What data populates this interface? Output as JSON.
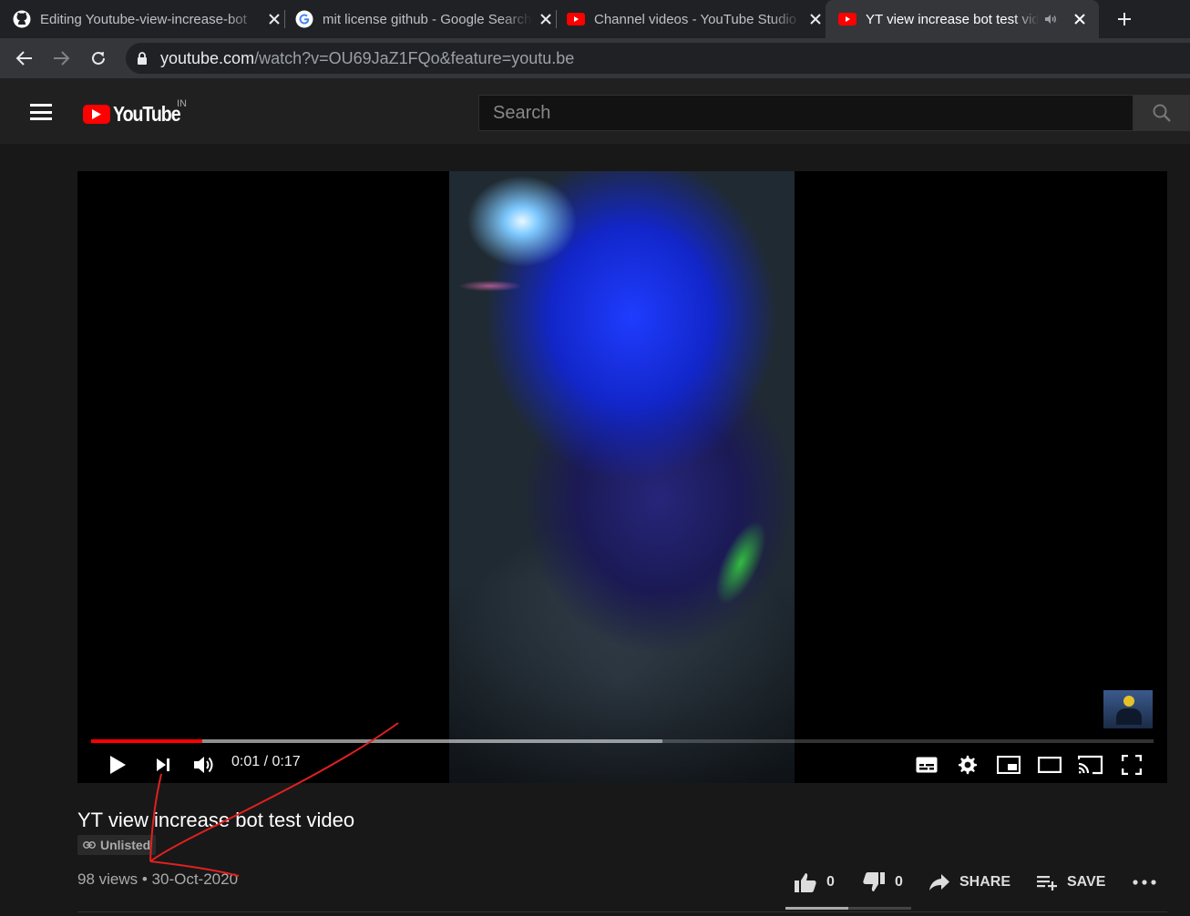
{
  "browser": {
    "tabs": [
      {
        "title": "Editing Youtube-view-increase-bot",
        "favicon": "github-icon"
      },
      {
        "title": "mit license github - Google Search",
        "favicon": "google-icon"
      },
      {
        "title": "Channel videos - YouTube Studio",
        "favicon": "youtube-icon"
      },
      {
        "title": "YT view increase bot test video",
        "favicon": "youtube-icon",
        "active": true,
        "audio": true
      }
    ],
    "url_host": "youtube.com",
    "url_path": "/watch?v=OU69JaZ1FQo&feature=youtu.be"
  },
  "masthead": {
    "logo_text": "YouTube",
    "country": "IN",
    "search_placeholder": "Search"
  },
  "player": {
    "current_time": "0:01",
    "duration": "0:17",
    "time_display": "0:01 / 0:17",
    "played_fraction": 0.105,
    "loaded_fraction": 0.538
  },
  "video": {
    "title": "YT view increase bot test video",
    "visibility": "Unlisted",
    "views": "98 views",
    "date": "30-Oct-2020",
    "meta_text": "98 views • 30-Oct-2020",
    "likes": "0",
    "dislikes": "0",
    "share_label": "SHARE",
    "save_label": "SAVE",
    "like_ratio": 0.5
  },
  "colors": {
    "accent": "#ff0000",
    "annotation": "#e02020"
  }
}
